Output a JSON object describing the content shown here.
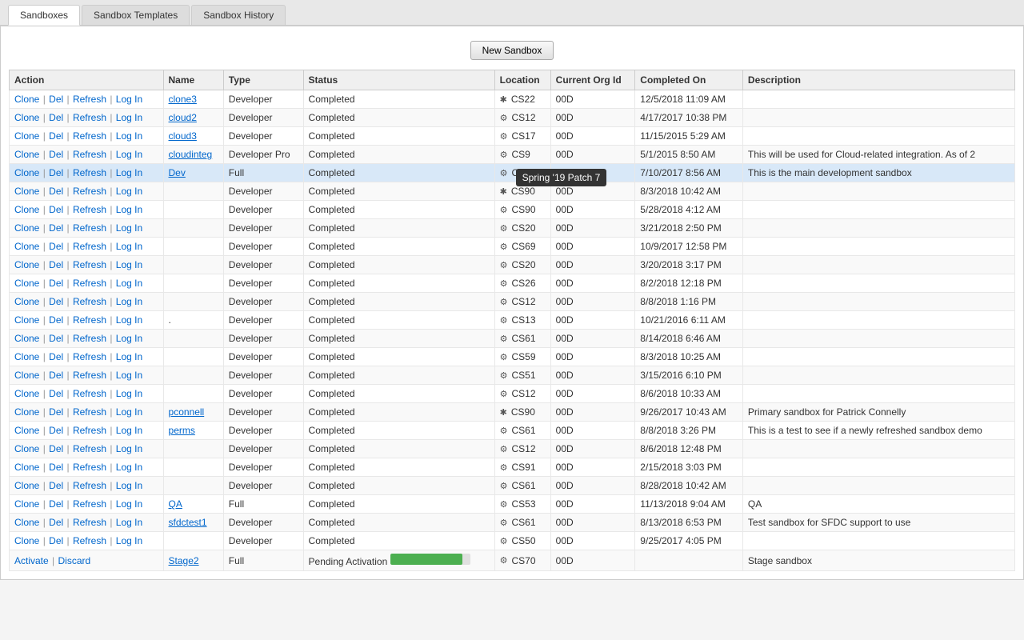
{
  "tabs": [
    {
      "label": "Sandboxes",
      "active": true
    },
    {
      "label": "Sandbox Templates",
      "active": false
    },
    {
      "label": "Sandbox History",
      "active": false
    }
  ],
  "toolbar": {
    "new_sandbox_label": "New Sandbox"
  },
  "table": {
    "headers": [
      "Action",
      "Name",
      "Type",
      "Status",
      "Location",
      "Current Org Id",
      "Completed On",
      "Description"
    ],
    "rows": [
      {
        "actions": [
          "Clone",
          "Del",
          "Refresh",
          "Log In"
        ],
        "name": "clone3",
        "name_link": true,
        "type": "Developer",
        "status": "Completed",
        "loc_icon": "gear",
        "location": "CS22",
        "org_id": "00D",
        "completed": "12/5/2018 11:09 AM",
        "description": ""
      },
      {
        "actions": [
          "Clone",
          "Del",
          "Refresh",
          "Log In"
        ],
        "name": "cloud2",
        "name_link": true,
        "type": "Developer",
        "status": "Completed",
        "loc_icon": "gear",
        "location": "CS12",
        "org_id": "00D",
        "completed": "4/17/2017 10:38 PM",
        "description": ""
      },
      {
        "actions": [
          "Clone",
          "Del",
          "Refresh",
          "Log In"
        ],
        "name": "cloud3",
        "name_link": true,
        "type": "Developer",
        "status": "Completed",
        "loc_icon": "gear",
        "location": "CS17",
        "org_id": "00D",
        "completed": "11/15/2015 5:29 AM",
        "description": ""
      },
      {
        "actions": [
          "Clone",
          "Del",
          "Refresh",
          "Log In"
        ],
        "name": "cloudinteg",
        "name_link": true,
        "type": "Developer Pro",
        "status": "Completed",
        "loc_icon": "gear",
        "location": "CS9",
        "org_id": "00D",
        "completed": "5/1/2015 8:50 AM",
        "description": "This will be used for Cloud-related integration. As of 2"
      },
      {
        "actions": [
          "Clone",
          "Del",
          "Refresh",
          "Log In"
        ],
        "name": "Dev",
        "name_link": true,
        "type": "Full",
        "status": "Completed",
        "loc_icon": "gear",
        "location": "CS91",
        "org_id": "00D",
        "completed": "7/10/2017 8:56 AM",
        "description": "This is the main development sandbox",
        "highlighted": true,
        "tooltip": "Spring '19 Patch 7"
      },
      {
        "actions": [
          "Clone",
          "Del",
          "Refresh",
          "Log In"
        ],
        "name": "",
        "name_link": false,
        "type": "Developer",
        "status": "Completed",
        "loc_icon": "gear",
        "location": "CS90",
        "org_id": "00D",
        "completed": "8/3/2018 10:42 AM",
        "description": ""
      },
      {
        "actions": [
          "Clone",
          "Del",
          "Refresh",
          "Log In"
        ],
        "name": "",
        "name_link": false,
        "type": "Developer",
        "status": "Completed",
        "loc_icon": "gear",
        "location": "CS90",
        "org_id": "00D",
        "completed": "5/28/2018 4:12 AM",
        "description": ""
      },
      {
        "actions": [
          "Clone",
          "Del",
          "Refresh",
          "Log In"
        ],
        "name": "",
        "name_link": false,
        "type": "Developer",
        "status": "Completed",
        "loc_icon": "gear",
        "location": "CS20",
        "org_id": "00D",
        "completed": "3/21/2018 2:50 PM",
        "description": ""
      },
      {
        "actions": [
          "Clone",
          "Del",
          "Refresh",
          "Log In"
        ],
        "name": "",
        "name_link": false,
        "type": "Developer",
        "status": "Completed",
        "loc_icon": "gear",
        "location": "CS69",
        "org_id": "00D",
        "completed": "10/9/2017 12:58 PM",
        "description": ""
      },
      {
        "actions": [
          "Clone",
          "Del",
          "Refresh",
          "Log In"
        ],
        "name": "",
        "name_link": false,
        "type": "Developer",
        "status": "Completed",
        "loc_icon": "gear",
        "location": "CS20",
        "org_id": "00D",
        "completed": "3/20/2018 3:17 PM",
        "description": ""
      },
      {
        "actions": [
          "Clone",
          "Del",
          "Refresh",
          "Log In"
        ],
        "name": "",
        "name_link": false,
        "type": "Developer",
        "status": "Completed",
        "loc_icon": "gear",
        "location": "CS26",
        "org_id": "00D",
        "completed": "8/2/2018 12:18 PM",
        "description": ""
      },
      {
        "actions": [
          "Clone",
          "Del",
          "Refresh",
          "Log In"
        ],
        "name": "",
        "name_link": false,
        "type": "Developer",
        "status": "Completed",
        "loc_icon": "gear",
        "location": "CS12",
        "org_id": "00D",
        "completed": "8/8/2018 1:16 PM",
        "description": ""
      },
      {
        "actions": [
          "Clone",
          "Del",
          "Refresh",
          "Log In"
        ],
        "name": ".",
        "name_link": false,
        "type": "Developer",
        "status": "Completed",
        "loc_icon": "gear",
        "location": "CS13",
        "org_id": "00D",
        "completed": "10/21/2016 6:11 AM",
        "description": ""
      },
      {
        "actions": [
          "Clone",
          "Del",
          "Refresh",
          "Log In"
        ],
        "name": "",
        "name_link": false,
        "type": "Developer",
        "status": "Completed",
        "loc_icon": "gear",
        "location": "CS61",
        "org_id": "00D",
        "completed": "8/14/2018 6:46 AM",
        "description": ""
      },
      {
        "actions": [
          "Clone",
          "Del",
          "Refresh",
          "Log In"
        ],
        "name": "",
        "name_link": false,
        "type": "Developer",
        "status": "Completed",
        "loc_icon": "gear",
        "location": "CS59",
        "org_id": "00D",
        "completed": "8/3/2018 10:25 AM",
        "description": ""
      },
      {
        "actions": [
          "Clone",
          "Del",
          "Refresh",
          "Log In"
        ],
        "name": "",
        "name_link": false,
        "type": "Developer",
        "status": "Completed",
        "loc_icon": "gear",
        "location": "CS51",
        "org_id": "00D",
        "completed": "3/15/2016 6:10 PM",
        "description": ""
      },
      {
        "actions": [
          "Clone",
          "Del",
          "Refresh",
          "Log In"
        ],
        "name": "",
        "name_link": false,
        "type": "Developer",
        "status": "Completed",
        "loc_icon": "gear",
        "location": "CS12",
        "org_id": "00D",
        "completed": "8/6/2018 10:33 AM",
        "description": ""
      },
      {
        "actions": [
          "Clone",
          "Del",
          "Refresh",
          "Log In"
        ],
        "name": "pconnell",
        "name_link": true,
        "type": "Developer",
        "status": "Completed",
        "loc_icon": "gear",
        "location": "CS90",
        "org_id": "00D",
        "completed": "9/26/2017 10:43 AM",
        "description": "Primary sandbox for Patrick Connelly"
      },
      {
        "actions": [
          "Clone",
          "Del",
          "Refresh",
          "Log In"
        ],
        "name": "perms",
        "name_link": true,
        "type": "Developer",
        "status": "Completed",
        "loc_icon": "gear",
        "location": "CS61",
        "org_id": "00D",
        "completed": "8/8/2018 3:26 PM",
        "description": "This is a test to see if a newly refreshed sandbox demo"
      },
      {
        "actions": [
          "Clone",
          "Del",
          "Refresh",
          "Log In"
        ],
        "name": "",
        "name_link": false,
        "type": "Developer",
        "status": "Completed",
        "loc_icon": "gear",
        "location": "CS12",
        "org_id": "00D",
        "completed": "8/6/2018 12:48 PM",
        "description": ""
      },
      {
        "actions": [
          "Clone",
          "Del",
          "Refresh",
          "Log In"
        ],
        "name": "",
        "name_link": false,
        "type": "Developer",
        "status": "Completed",
        "loc_icon": "gear",
        "location": "CS91",
        "org_id": "00D",
        "completed": "2/15/2018 3:03 PM",
        "description": ""
      },
      {
        "actions": [
          "Clone",
          "Del",
          "Refresh",
          "Log In"
        ],
        "name": "",
        "name_link": false,
        "type": "Developer",
        "status": "Completed",
        "loc_icon": "gear",
        "location": "CS61",
        "org_id": "00D",
        "completed": "8/28/2018 10:42 AM",
        "description": ""
      },
      {
        "actions": [
          "Clone",
          "Del",
          "Refresh",
          "Log In"
        ],
        "name": "QA",
        "name_link": true,
        "type": "Full",
        "status": "Completed",
        "loc_icon": "gear",
        "location": "CS53",
        "org_id": "00D",
        "completed": "11/13/2018 9:04 AM",
        "description": "QA"
      },
      {
        "actions": [
          "Clone",
          "Del",
          "Refresh",
          "Log In"
        ],
        "name": "sfdctest1",
        "name_link": true,
        "type": "Developer",
        "status": "Completed",
        "loc_icon": "gear",
        "location": "CS61",
        "org_id": "00D",
        "completed": "8/13/2018 6:53 PM",
        "description": "Test sandbox for SFDC support to use"
      },
      {
        "actions": [
          "Clone",
          "Del",
          "Refresh",
          "Log In"
        ],
        "name": "",
        "name_link": false,
        "type": "Developer",
        "status": "Completed",
        "loc_icon": "gear",
        "location": "CS50",
        "org_id": "00D",
        "completed": "9/25/2017 4:05 PM",
        "description": ""
      },
      {
        "actions": [
          "Activate",
          "Discard"
        ],
        "name": "Stage2",
        "name_link": true,
        "type": "Full",
        "status": "Pending Activation",
        "status_progress": 90,
        "loc_icon": "gear",
        "location": "CS70",
        "org_id": "00D",
        "completed": "",
        "description": "Stage sandbox",
        "pending": true
      }
    ],
    "tooltip": {
      "row_index": 4,
      "text": "Spring '19 Patch 7"
    }
  }
}
